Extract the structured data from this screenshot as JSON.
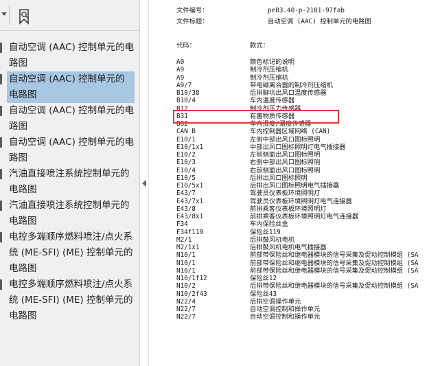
{
  "sidebar": {
    "items": [
      {
        "label": "自动空调 (AAC) 控制单元的电路图",
        "selected": false
      },
      {
        "label": "自动空调 (AAC) 控制单元的电路图",
        "selected": true
      },
      {
        "label": "自动空调 (AAC) 控制单元的电路图",
        "selected": false
      },
      {
        "label": "自动空调 (AAC) 控制单元的电路图",
        "selected": false
      },
      {
        "label": "汽油直接喷注系统控制单元的电路图",
        "selected": false
      },
      {
        "label": "汽油直接喷注系统控制单元的电路图",
        "selected": false
      },
      {
        "label": "电控多端顺序燃料喷注/点火系统 (ME-SFI) (ME) 控制单元的电路图",
        "selected": false
      },
      {
        "label": "电控多端顺序燃料喷注/点火系统 (ME-SFI) (ME) 控制单元的电路图",
        "selected": false
      }
    ]
  },
  "document": {
    "doc_number_label": "文件编号：",
    "doc_number_value": "pe83.40-p-2101-97fab",
    "doc_title_label": "文件标题：",
    "doc_title_value": "自动空调 (AAC) 控制单元的电路图",
    "col_code": "代码：",
    "col_model": "款式：",
    "rows": [
      {
        "code": "A0",
        "desc": "颜色标记的说明"
      },
      {
        "code": "A9",
        "desc": "制冷剂压缩机"
      },
      {
        "code": "A9",
        "desc": "制冷剂压缩机"
      },
      {
        "code": "A9/7",
        "desc": "带电磁离合器的制冷剂压缩机"
      },
      {
        "code": "B10/38",
        "desc": "后排脚坑出风口温度传感器"
      },
      {
        "code": "B10/4",
        "desc": "车内温度传感器"
      },
      {
        "code": "B12",
        "desc": "制冷剂压力传感器"
      },
      {
        "code": "B31",
        "desc": "有害物质传感器"
      },
      {
        "code": "B82",
        "desc": "车内湿度/温度传感器"
      },
      {
        "code": "CAN B",
        "desc": "车内控制器区域网络 (CAN)"
      },
      {
        "code": "E10/1",
        "desc": "左侧中部出风口图标照明"
      },
      {
        "code": "E10/1x1",
        "desc": "中部出风口图标照明灯电气插接器"
      },
      {
        "code": "E10/2",
        "desc": "左前侧面出风口图标照明"
      },
      {
        "code": "E10/3",
        "desc": "右侧中部出风口图标照明"
      },
      {
        "code": "E10/4",
        "desc": "右前侧面出风口图标照明"
      },
      {
        "code": "E10/5",
        "desc": "后排出风口图标照明"
      },
      {
        "code": "E10/5x1",
        "desc": "后排出风口图标照明电气插接器"
      },
      {
        "code": "E43/7",
        "desc": "驾驶员仪表板环境照明灯"
      },
      {
        "code": "E43/7x1",
        "desc": "驾驶员仪表板环境照明灯电气连接器"
      },
      {
        "code": "E43/8",
        "desc": "前排乘客仪表板环境照明灯"
      },
      {
        "code": "E43/8x1",
        "desc": "前排乘客仪表板环境照明灯电气连接器"
      },
      {
        "code": "F34",
        "desc": "车内保险丝盒"
      },
      {
        "code": "F34f119",
        "desc": "保险丝119"
      },
      {
        "code": "M2/1",
        "desc": "后排鼓风机电机"
      },
      {
        "code": "M2/1x1",
        "desc": "后排鼓风机电机电气插接器"
      },
      {
        "code": "N10/1",
        "desc": "前部带保险丝和继电器模块的信号采集及促动控制模组 (SA"
      },
      {
        "code": "N10/1",
        "desc": "前部带保险丝和继电器模块的信号采集及促动控制模组 (SA"
      },
      {
        "code": "N10/1",
        "desc": "前部带保险丝和继电器模块的信号采集及促动控制模组 (SA"
      },
      {
        "code": "N10/1f12",
        "desc": "保险丝12"
      },
      {
        "code": "N10/2",
        "desc": "后排带保险丝和继电器模块的信号采集及促动控制模组 (SA"
      },
      {
        "code": "N10/2f43",
        "desc": "保险丝43"
      },
      {
        "code": "N22/4",
        "desc": "后排空调操作单元"
      },
      {
        "code": "N22/7",
        "desc": "自动空调控制和操作单元"
      },
      {
        "code": "N22/7",
        "desc": "自动空调控制和操作单元"
      }
    ]
  },
  "colors": {
    "highlight_box": "#e53935",
    "selected_bg": "#a8c7e3"
  },
  "icons": [
    "chevron-down-icon",
    "bookmark-icon",
    "collapse-left-icon"
  ]
}
